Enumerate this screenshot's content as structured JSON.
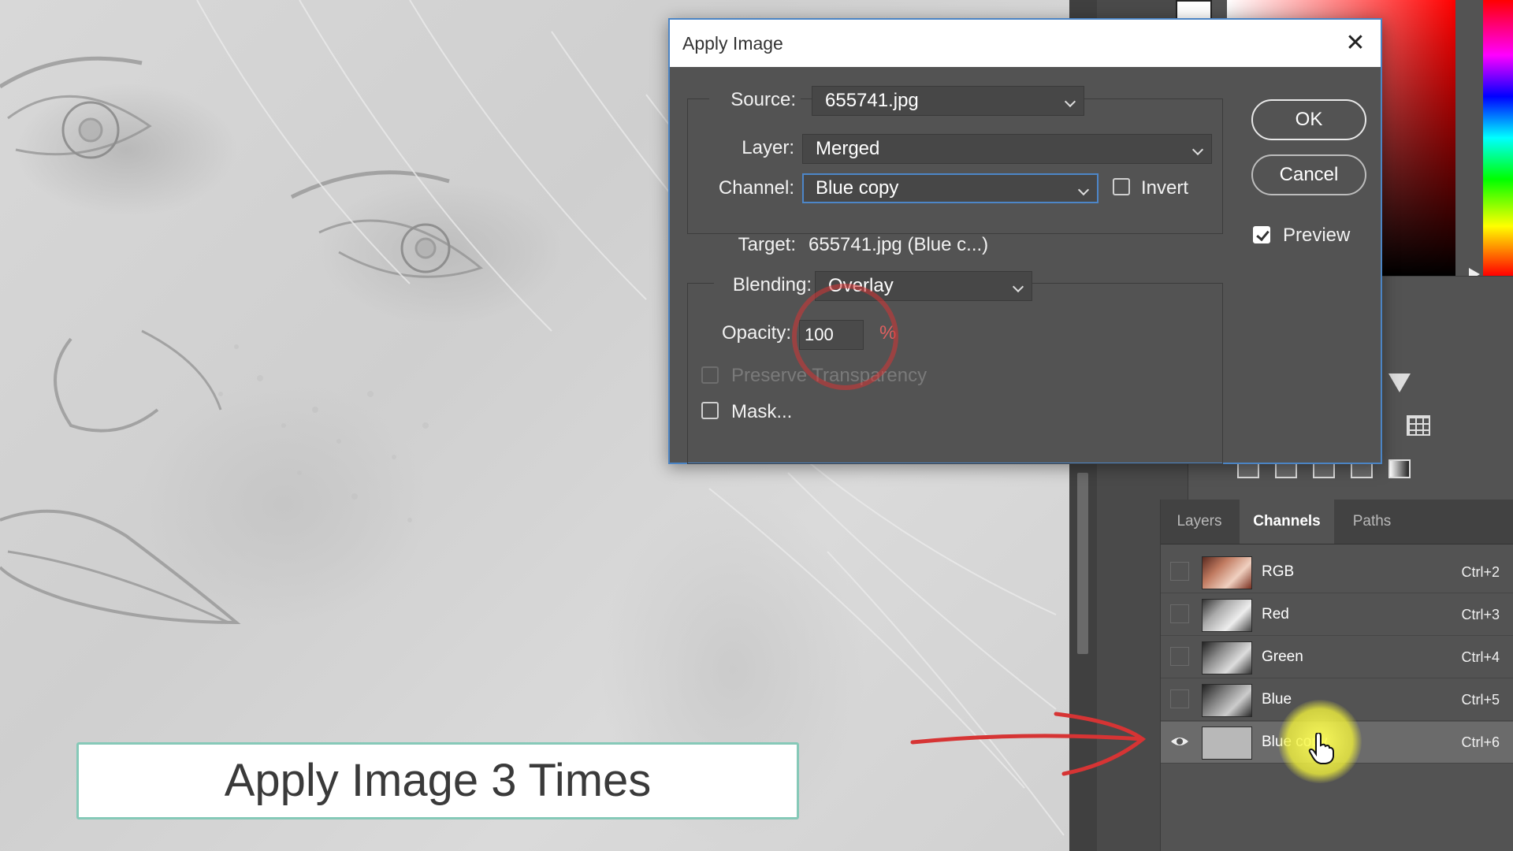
{
  "dialog": {
    "title": "Apply Image",
    "source_label": "Source:",
    "source_value": "655741.jpg",
    "layer_label": "Layer:",
    "layer_value": "Merged",
    "channel_label": "Channel:",
    "channel_value": "Blue copy",
    "invert_label": "Invert",
    "invert_checked": false,
    "target_label": "Target:",
    "target_value": "655741.jpg (Blue c...)",
    "blending_label": "Blending:",
    "blending_value": "Overlay",
    "opacity_label": "Opacity:",
    "opacity_value": "100",
    "opacity_unit": "%",
    "preserve_transparency_label": "Preserve Transparency",
    "preserve_transparency_enabled": false,
    "mask_label": "Mask...",
    "mask_checked": false,
    "ok_label": "OK",
    "cancel_label": "Cancel",
    "preview_label": "Preview",
    "preview_checked": true
  },
  "panel": {
    "tabs": [
      {
        "label": "Layers",
        "active": false
      },
      {
        "label": "Channels",
        "active": true
      },
      {
        "label": "Paths",
        "active": false
      }
    ],
    "channels": [
      {
        "name": "RGB",
        "shortcut": "Ctrl+2",
        "visible": false,
        "selected": false
      },
      {
        "name": "Red",
        "shortcut": "Ctrl+3",
        "visible": false,
        "selected": false
      },
      {
        "name": "Green",
        "shortcut": "Ctrl+4",
        "visible": false,
        "selected": false
      },
      {
        "name": "Blue",
        "shortcut": "Ctrl+5",
        "visible": false,
        "selected": false
      },
      {
        "name": "Blue copy",
        "shortcut": "Ctrl+6",
        "visible": true,
        "selected": true
      }
    ]
  },
  "caption": {
    "text": "Apply Image 3 Times"
  },
  "colors": {
    "dialog_bg": "#535353",
    "focus_blue": "#4d86c8",
    "annotation_red": "#d63434",
    "highlight_yellow": "#f0f03c",
    "caption_border": "#86c9b8"
  }
}
